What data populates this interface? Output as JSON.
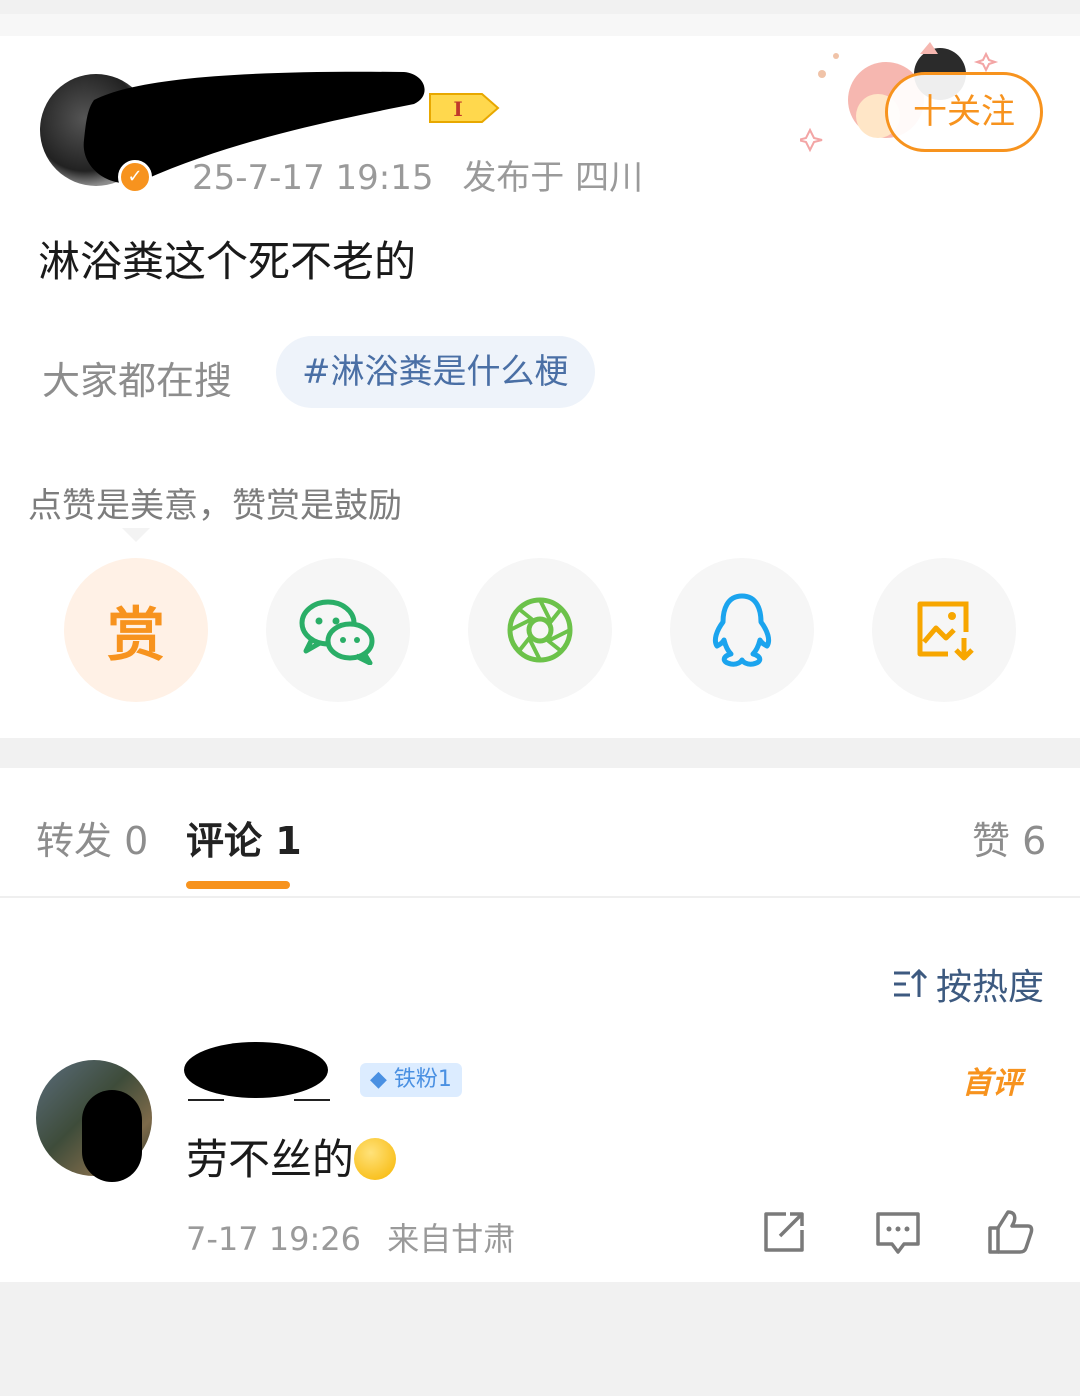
{
  "post": {
    "timestamp": "25-7-17 19:15",
    "published_in": "发布于 四川",
    "text": "淋浴粪这个死不老的",
    "follow_label": "十关注",
    "level_badge": "I",
    "search_label": "大家都在搜",
    "search_chip": "#淋浴粪是什么梗",
    "reward_tip": "点赞是美意，赞赏是鼓励",
    "share": {
      "reward_label": "赏",
      "icons": [
        "reward-icon",
        "wechat-icon",
        "moments-icon",
        "qq-icon",
        "save-image-icon"
      ]
    }
  },
  "tabs": {
    "repost": "转发 0",
    "comment": "评论 1",
    "like": "赞 6"
  },
  "sort_label": "按热度",
  "comment": {
    "fan_badge": "铁粉1",
    "first_badge": "首评",
    "text": "劳不丝的",
    "time": "7-17 19:26",
    "location": "来自甘肃"
  },
  "colors": {
    "accent": "#f7931e",
    "link": "#3d5a80",
    "wechat": "#2aae67",
    "qq": "#1ba4ee"
  }
}
